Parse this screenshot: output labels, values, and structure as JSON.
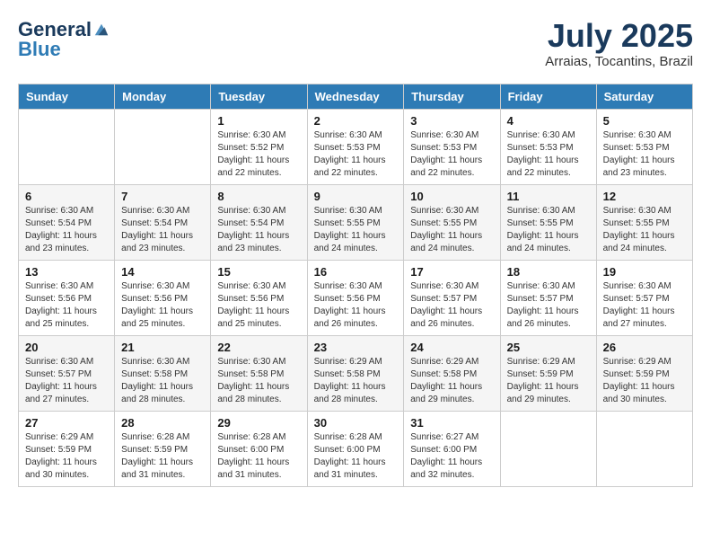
{
  "logo": {
    "general": "General",
    "blue": "Blue"
  },
  "header": {
    "month": "July 2025",
    "location": "Arraias, Tocantins, Brazil"
  },
  "days_of_week": [
    "Sunday",
    "Monday",
    "Tuesday",
    "Wednesday",
    "Thursday",
    "Friday",
    "Saturday"
  ],
  "weeks": [
    [
      {
        "day": "",
        "info": ""
      },
      {
        "day": "",
        "info": ""
      },
      {
        "day": "1",
        "info": "Sunrise: 6:30 AM\nSunset: 5:52 PM\nDaylight: 11 hours and 22 minutes."
      },
      {
        "day": "2",
        "info": "Sunrise: 6:30 AM\nSunset: 5:53 PM\nDaylight: 11 hours and 22 minutes."
      },
      {
        "day": "3",
        "info": "Sunrise: 6:30 AM\nSunset: 5:53 PM\nDaylight: 11 hours and 22 minutes."
      },
      {
        "day": "4",
        "info": "Sunrise: 6:30 AM\nSunset: 5:53 PM\nDaylight: 11 hours and 22 minutes."
      },
      {
        "day": "5",
        "info": "Sunrise: 6:30 AM\nSunset: 5:53 PM\nDaylight: 11 hours and 23 minutes."
      }
    ],
    [
      {
        "day": "6",
        "info": "Sunrise: 6:30 AM\nSunset: 5:54 PM\nDaylight: 11 hours and 23 minutes."
      },
      {
        "day": "7",
        "info": "Sunrise: 6:30 AM\nSunset: 5:54 PM\nDaylight: 11 hours and 23 minutes."
      },
      {
        "day": "8",
        "info": "Sunrise: 6:30 AM\nSunset: 5:54 PM\nDaylight: 11 hours and 23 minutes."
      },
      {
        "day": "9",
        "info": "Sunrise: 6:30 AM\nSunset: 5:55 PM\nDaylight: 11 hours and 24 minutes."
      },
      {
        "day": "10",
        "info": "Sunrise: 6:30 AM\nSunset: 5:55 PM\nDaylight: 11 hours and 24 minutes."
      },
      {
        "day": "11",
        "info": "Sunrise: 6:30 AM\nSunset: 5:55 PM\nDaylight: 11 hours and 24 minutes."
      },
      {
        "day": "12",
        "info": "Sunrise: 6:30 AM\nSunset: 5:55 PM\nDaylight: 11 hours and 24 minutes."
      }
    ],
    [
      {
        "day": "13",
        "info": "Sunrise: 6:30 AM\nSunset: 5:56 PM\nDaylight: 11 hours and 25 minutes."
      },
      {
        "day": "14",
        "info": "Sunrise: 6:30 AM\nSunset: 5:56 PM\nDaylight: 11 hours and 25 minutes."
      },
      {
        "day": "15",
        "info": "Sunrise: 6:30 AM\nSunset: 5:56 PM\nDaylight: 11 hours and 25 minutes."
      },
      {
        "day": "16",
        "info": "Sunrise: 6:30 AM\nSunset: 5:56 PM\nDaylight: 11 hours and 26 minutes."
      },
      {
        "day": "17",
        "info": "Sunrise: 6:30 AM\nSunset: 5:57 PM\nDaylight: 11 hours and 26 minutes."
      },
      {
        "day": "18",
        "info": "Sunrise: 6:30 AM\nSunset: 5:57 PM\nDaylight: 11 hours and 26 minutes."
      },
      {
        "day": "19",
        "info": "Sunrise: 6:30 AM\nSunset: 5:57 PM\nDaylight: 11 hours and 27 minutes."
      }
    ],
    [
      {
        "day": "20",
        "info": "Sunrise: 6:30 AM\nSunset: 5:57 PM\nDaylight: 11 hours and 27 minutes."
      },
      {
        "day": "21",
        "info": "Sunrise: 6:30 AM\nSunset: 5:58 PM\nDaylight: 11 hours and 28 minutes."
      },
      {
        "day": "22",
        "info": "Sunrise: 6:30 AM\nSunset: 5:58 PM\nDaylight: 11 hours and 28 minutes."
      },
      {
        "day": "23",
        "info": "Sunrise: 6:29 AM\nSunset: 5:58 PM\nDaylight: 11 hours and 28 minutes."
      },
      {
        "day": "24",
        "info": "Sunrise: 6:29 AM\nSunset: 5:58 PM\nDaylight: 11 hours and 29 minutes."
      },
      {
        "day": "25",
        "info": "Sunrise: 6:29 AM\nSunset: 5:59 PM\nDaylight: 11 hours and 29 minutes."
      },
      {
        "day": "26",
        "info": "Sunrise: 6:29 AM\nSunset: 5:59 PM\nDaylight: 11 hours and 30 minutes."
      }
    ],
    [
      {
        "day": "27",
        "info": "Sunrise: 6:29 AM\nSunset: 5:59 PM\nDaylight: 11 hours and 30 minutes."
      },
      {
        "day": "28",
        "info": "Sunrise: 6:28 AM\nSunset: 5:59 PM\nDaylight: 11 hours and 31 minutes."
      },
      {
        "day": "29",
        "info": "Sunrise: 6:28 AM\nSunset: 6:00 PM\nDaylight: 11 hours and 31 minutes."
      },
      {
        "day": "30",
        "info": "Sunrise: 6:28 AM\nSunset: 6:00 PM\nDaylight: 11 hours and 31 minutes."
      },
      {
        "day": "31",
        "info": "Sunrise: 6:27 AM\nSunset: 6:00 PM\nDaylight: 11 hours and 32 minutes."
      },
      {
        "day": "",
        "info": ""
      },
      {
        "day": "",
        "info": ""
      }
    ]
  ]
}
